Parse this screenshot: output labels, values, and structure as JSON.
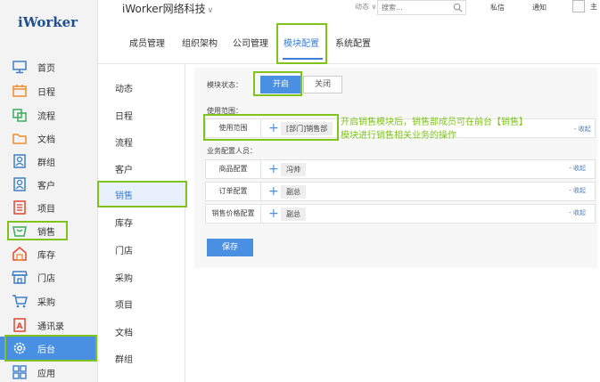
{
  "sidebar": {
    "logo": "iWorker",
    "items": [
      {
        "label": "首页",
        "icon": "monitor-icon"
      },
      {
        "label": "日程",
        "icon": "calendar-icon"
      },
      {
        "label": "流程",
        "icon": "flow-icon"
      },
      {
        "label": "文档",
        "icon": "folder-icon"
      },
      {
        "label": "群组",
        "icon": "group-icon"
      },
      {
        "label": "客户",
        "icon": "customer-icon"
      },
      {
        "label": "项目",
        "icon": "project-icon"
      },
      {
        "label": "销售",
        "icon": "basket-icon"
      },
      {
        "label": "库存",
        "icon": "warehouse-icon"
      },
      {
        "label": "门店",
        "icon": "store-icon"
      },
      {
        "label": "采购",
        "icon": "cart-icon"
      },
      {
        "label": "通讯录",
        "icon": "contacts-icon"
      },
      {
        "label": "后台",
        "icon": "gear-icon"
      },
      {
        "label": "应用",
        "icon": "apps-grid-icon"
      }
    ],
    "active": "后台"
  },
  "topbar": {
    "company": "iWorker网络科技",
    "dynamic_select": "动态",
    "search_placeholder": "搜索...",
    "links": [
      "私信",
      "通知"
    ],
    "more": "主"
  },
  "tabs": {
    "items": [
      "成员管理",
      "组织架构",
      "公司管理",
      "模块配置",
      "系统配置"
    ],
    "active": "模块配置"
  },
  "subnav": {
    "items": [
      "动态",
      "日程",
      "流程",
      "客户",
      "销售",
      "库存",
      "门店",
      "采购",
      "项目",
      "文档",
      "群组"
    ],
    "active": "销售"
  },
  "panel": {
    "status_label": "模块状态：",
    "on_label": "开启",
    "off_label": "关闭",
    "scope_heading": "使用范围：",
    "scope_row_label": "使用范围",
    "scope_tag": "[部门]销售部",
    "config_heading": "业务配置人员：",
    "config_rows": [
      {
        "label": "商品配置",
        "tag": "冯帅",
        "collapse": "- 收起"
      },
      {
        "label": "订单配置",
        "tag": "副总",
        "collapse": "- 收起"
      },
      {
        "label": "销售价格配置",
        "tag": "副总",
        "collapse": "- 收起"
      }
    ],
    "scope_collapse": "- 收起",
    "save_label": "保存"
  },
  "annotation": {
    "line1": "开启销售模块后，销售部成员可在前台【销售】",
    "line2": "模块进行销售相关业务的操作"
  },
  "colors": {
    "accent": "#4a90e2",
    "highlight": "#7fc31c",
    "link": "#3c7ed8"
  }
}
